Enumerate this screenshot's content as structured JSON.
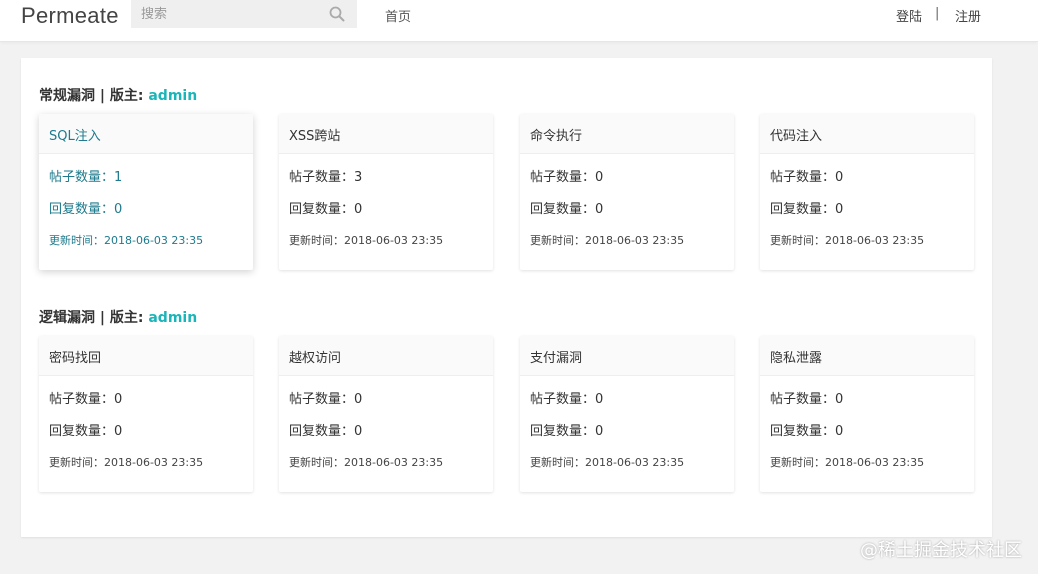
{
  "header": {
    "logo": "Permeate",
    "search_placeholder": "搜索",
    "home_label": "首页",
    "login_label": "登陆",
    "separator": "|",
    "register_label": "注册"
  },
  "sections": [
    {
      "title_prefix": "常规漏洞 | 版主: ",
      "moderator": "admin",
      "cards": [
        {
          "title": "SQL注入",
          "posts": "帖子数量：1",
          "replies": "回复数量：0",
          "updated": "更新时间：2018-06-03 23:35"
        },
        {
          "title": "XSS跨站",
          "posts": "帖子数量：3",
          "replies": "回复数量：0",
          "updated": "更新时间：2018-06-03 23:35"
        },
        {
          "title": "命令执行",
          "posts": "帖子数量：0",
          "replies": "回复数量：0",
          "updated": "更新时间：2018-06-03 23:35"
        },
        {
          "title": "代码注入",
          "posts": "帖子数量：0",
          "replies": "回复数量：0",
          "updated": "更新时间：2018-06-03 23:35"
        }
      ]
    },
    {
      "title_prefix": "逻辑漏洞 | 版主: ",
      "moderator": "admin",
      "cards": [
        {
          "title": "密码找回",
          "posts": "帖子数量：0",
          "replies": "回复数量：0",
          "updated": "更新时间：2018-06-03 23:35"
        },
        {
          "title": "越权访问",
          "posts": "帖子数量：0",
          "replies": "回复数量：0",
          "updated": "更新时间：2018-06-03 23:35"
        },
        {
          "title": "支付漏洞",
          "posts": "帖子数量：0",
          "replies": "回复数量：0",
          "updated": "更新时间：2018-06-03 23:35"
        },
        {
          "title": "隐私泄露",
          "posts": "帖子数量：0",
          "replies": "回复数量：0",
          "updated": "更新时间：2018-06-03 23:35"
        }
      ]
    }
  ],
  "watermark": "@稀土掘金技术社区",
  "colors": {
    "accent": "#1ab5b9",
    "active_text": "#1e7a8c"
  }
}
